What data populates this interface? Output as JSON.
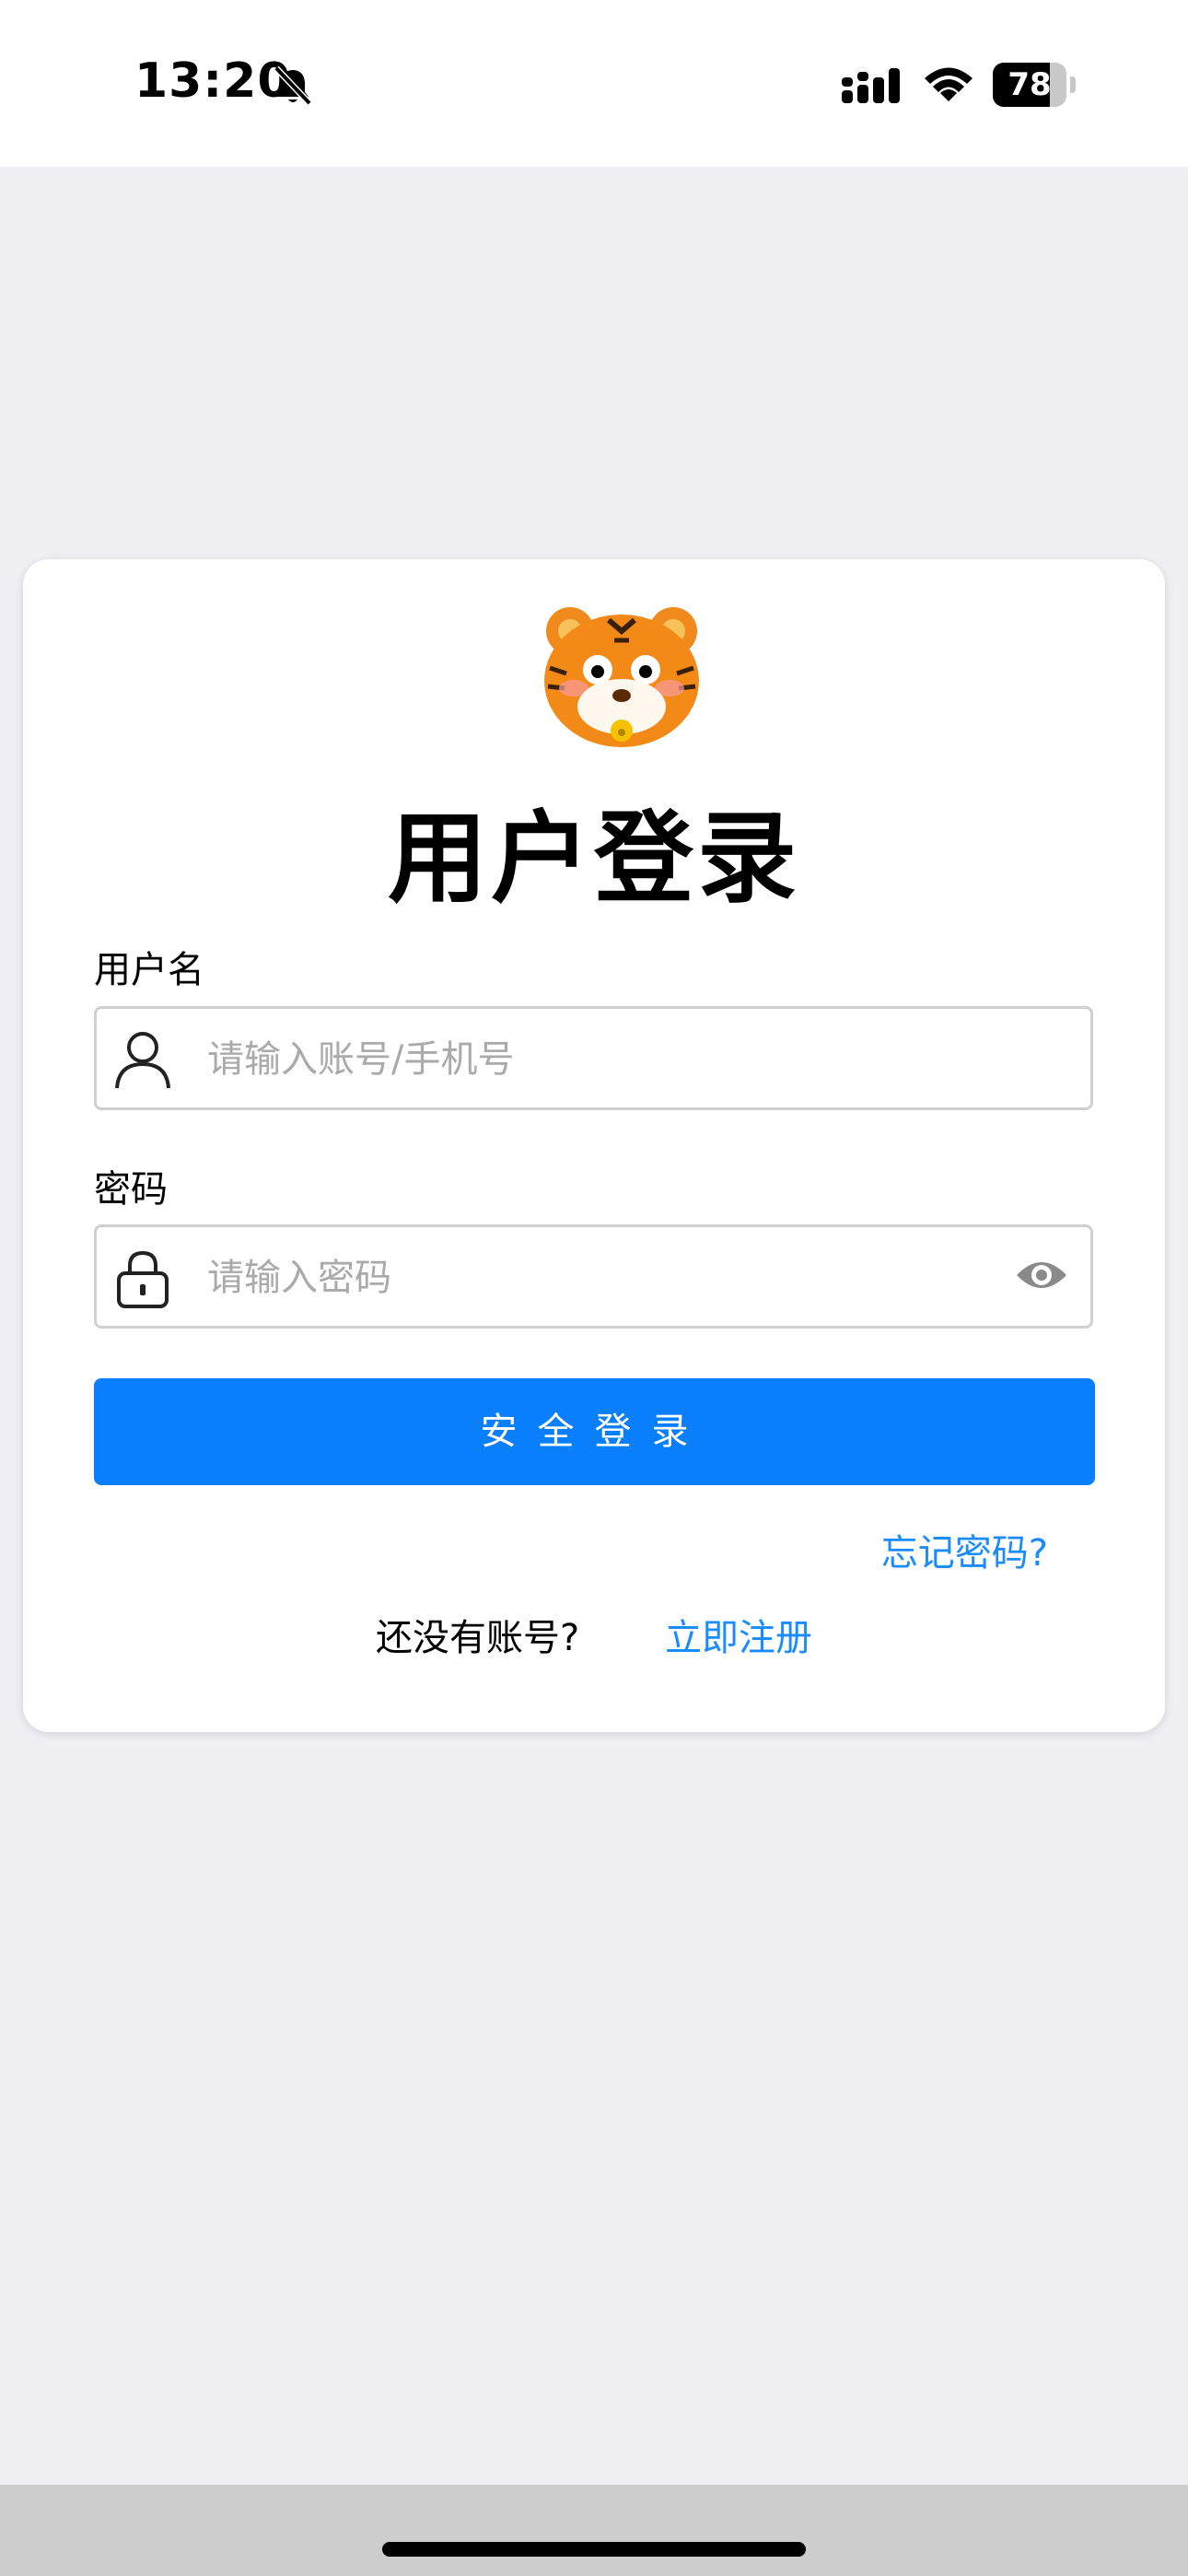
{
  "status_bar": {
    "time": "13:20",
    "battery_level": "78",
    "battery_fraction": 0.78
  },
  "login": {
    "title": "用户登录",
    "username_label": "用户名",
    "username_placeholder": "请输入账号/手机号",
    "password_label": "密码",
    "password_placeholder": "请输入密码",
    "login_button": "安全登录",
    "forgot_password": "忘记密码?",
    "no_account": "还没有账号?",
    "register": "立即注册"
  },
  "colors": {
    "accent": "#0a7ffe",
    "link": "#1a8cff",
    "background": "#efeff4",
    "card": "#ffffff"
  },
  "icons": {
    "mascot": "tiger-mascot-icon",
    "username": "user-icon",
    "password": "lock-icon",
    "toggle_password": "eye-icon",
    "mute": "bell-slash-icon",
    "signal": "signal-icon",
    "wifi": "wifi-icon"
  }
}
